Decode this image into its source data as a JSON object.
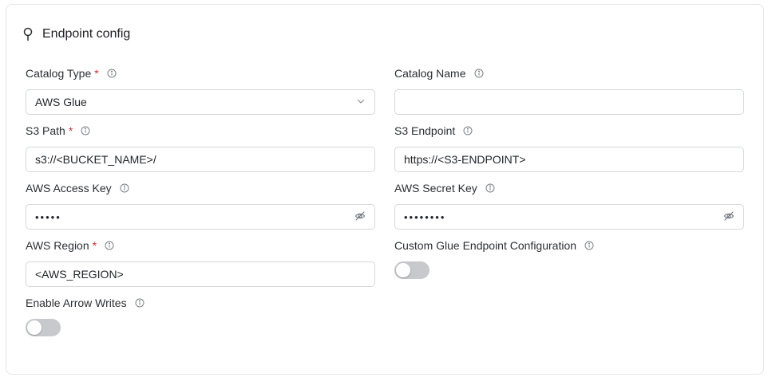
{
  "panel": {
    "title": "Endpoint config",
    "header_icon": "pin-icon"
  },
  "fields": {
    "catalog_type": {
      "label": "Catalog Type",
      "required": "*",
      "value": "AWS Glue",
      "icon": "chevron-down-icon"
    },
    "catalog_name": {
      "label": "Catalog Name",
      "value": ""
    },
    "s3_path": {
      "label": "S3 Path",
      "required": "*",
      "value": "s3://<BUCKET_NAME>/"
    },
    "s3_endpoint": {
      "label": "S3 Endpoint",
      "value": "https://<S3-ENDPOINT>"
    },
    "aws_access_key": {
      "label": "AWS Access Key",
      "value": "•••••",
      "icon": "eye-off-icon"
    },
    "aws_secret_key": {
      "label": "AWS Secret Key",
      "value": "••••••••",
      "icon": "eye-off-icon"
    },
    "aws_region": {
      "label": "AWS Region",
      "required": "*",
      "value": "<AWS_REGION>"
    },
    "custom_glue_endpoint": {
      "label": "Custom Glue Endpoint Configuration",
      "enabled": false
    },
    "enable_arrow_writes": {
      "label": "Enable Arrow Writes",
      "enabled": false
    }
  },
  "colors": {
    "required": "#d32f2f",
    "border": "#d4d7db",
    "toggle_off": "#c7c9cc"
  }
}
